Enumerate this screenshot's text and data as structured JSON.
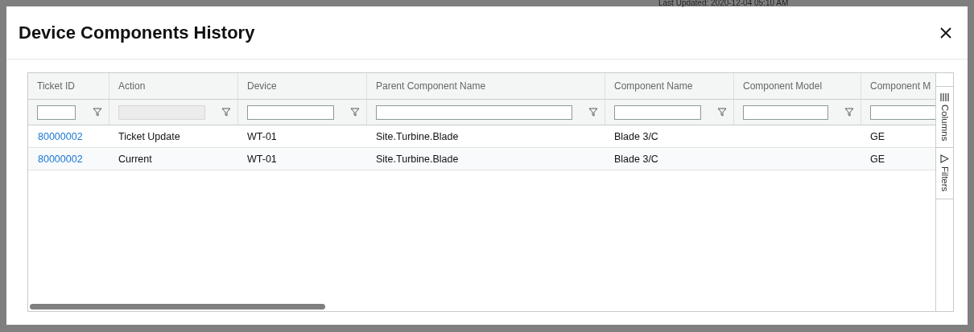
{
  "backdrop": {
    "last_updated": "Last Updated: 2020-12-04 05:10 AM"
  },
  "dialog": {
    "title": "Device Components History"
  },
  "grid": {
    "columns": [
      {
        "label": "Ticket ID",
        "filter_disabled": false
      },
      {
        "label": "Action",
        "filter_disabled": true
      },
      {
        "label": "Device",
        "filter_disabled": false
      },
      {
        "label": "Parent Component Name",
        "filter_disabled": false
      },
      {
        "label": "Component Name",
        "filter_disabled": false
      },
      {
        "label": "Component Model",
        "filter_disabled": false
      },
      {
        "label": "Component M",
        "filter_disabled": false
      }
    ],
    "rows": [
      {
        "cells": [
          "80000002",
          "Ticket Update",
          "WT-01",
          "Site.Turbine.Blade",
          "Blade 3/C",
          "",
          "GE"
        ]
      },
      {
        "cells": [
          "80000002",
          "Current",
          "WT-01",
          "Site.Turbine.Blade",
          "Blade 3/C",
          "",
          "GE"
        ]
      }
    ],
    "side_panel": [
      {
        "kind": "columns",
        "label": "Columns"
      },
      {
        "kind": "filters",
        "label": "Filters"
      }
    ]
  }
}
